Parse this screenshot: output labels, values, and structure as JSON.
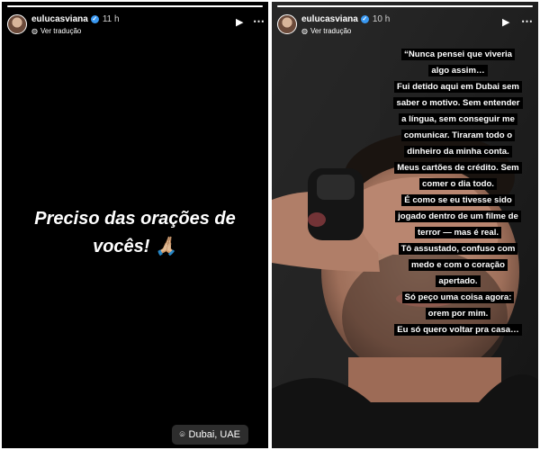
{
  "stories": [
    {
      "username": "eulucasviana",
      "time": "11 h",
      "translate_label": "Ver tradução",
      "text_lines": [
        "Preciso das orações de",
        "vocês! 🙏🏼"
      ],
      "location": "Dubai, UAE"
    },
    {
      "username": "eulucasviana",
      "time": "10 h",
      "translate_label": "Ver tradução",
      "caption_lines": [
        "“Nunca pensei que viveria",
        "algo assim…",
        "Fui detido aqui em Dubai sem",
        "saber o motivo. Sem entender",
        "a língua, sem conseguir me",
        "comunicar. Tiraram todo o",
        "dinheiro da minha conta.",
        "Meus cartões de crédito. Sem",
        "comer o dia todo.",
        "É como se eu tivesse sido",
        "jogado dentro de um filme de",
        "terror — mas é real.",
        "Tô assustado, confuso com",
        "medo e com o coração",
        "apertado.",
        "Só peço uma coisa agora:",
        "orem por mim.",
        "Eu só quero voltar pra casa…"
      ]
    }
  ],
  "colors": {
    "story_bg": "#000000",
    "caption_bg": "#000000",
    "verified_blue": "#3897f0",
    "location_sticker_bg": "#2d2d2d"
  },
  "icons": [
    "verified-badge-icon",
    "globe-icon",
    "play-icon",
    "more-options-icon",
    "location-pin-icon"
  ]
}
